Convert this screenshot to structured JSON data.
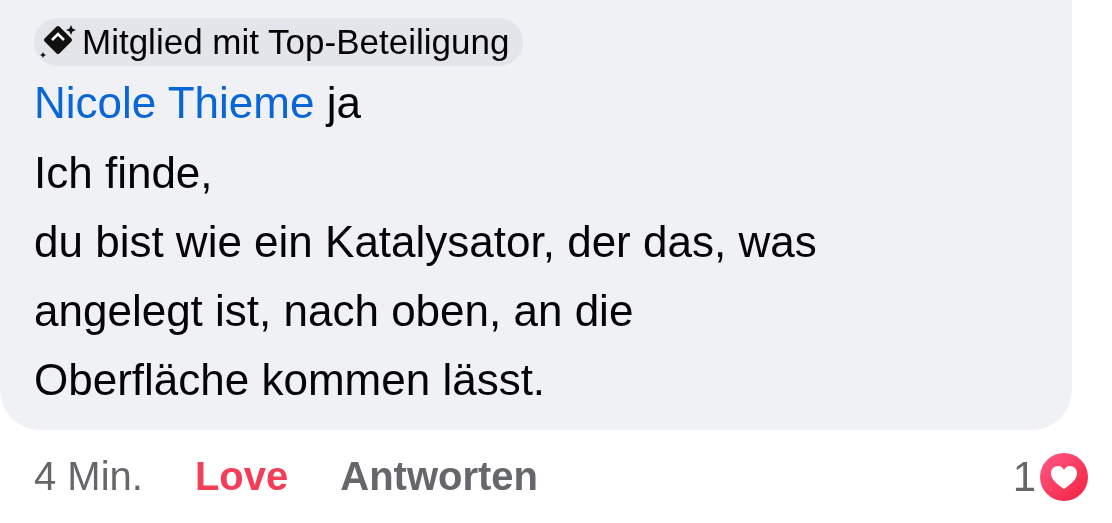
{
  "comment": {
    "badge": "Mitglied mit Top-Beteiligung",
    "mention": "Nicole Thieme",
    "first_line_rest": "ja",
    "text_lines": [
      "Ich finde,",
      "du bist wie ein Katalysator, der das, was",
      "angelegt ist, nach oben, an die",
      "Oberfläche kommen lässt."
    ]
  },
  "footer": {
    "time": "4 Min.",
    "reaction": {
      "label": "Love",
      "active": true
    },
    "reply": "Antworten",
    "reaction_count": "1"
  }
}
